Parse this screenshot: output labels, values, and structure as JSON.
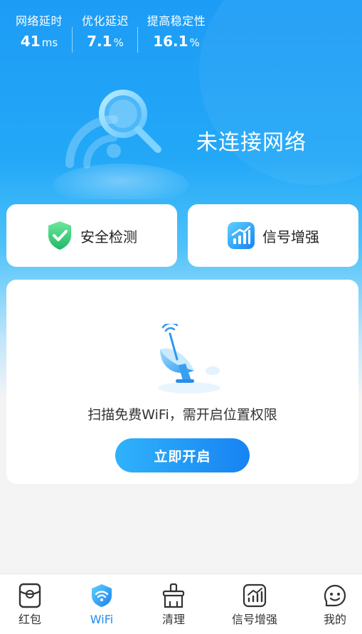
{
  "stats": [
    {
      "label": "网络延时",
      "value": "41",
      "unit": "ms"
    },
    {
      "label": "优化延迟",
      "value": "7.1",
      "unit": "%"
    },
    {
      "label": "提高稳定性",
      "value": "16.1",
      "unit": "%"
    }
  ],
  "hero": {
    "status": "未连接网络",
    "icon": "magnifier-radar-icon"
  },
  "actions": [
    {
      "label": "安全检测",
      "icon": "shield-check-icon"
    },
    {
      "label": "信号增强",
      "icon": "signal-chart-icon"
    }
  ],
  "scan": {
    "message": "扫描免费WiFi，需开启位置权限",
    "button": "立即开启",
    "icon": "satellite-dish-icon"
  },
  "tabs": [
    {
      "label": "红包",
      "icon": "red-packet-icon"
    },
    {
      "label": "WiFi",
      "icon": "wifi-icon"
    },
    {
      "label": "清理",
      "icon": "broom-icon"
    },
    {
      "label": "信号增强",
      "icon": "signal-chart-icon"
    },
    {
      "label": "我的",
      "icon": "profile-icon"
    }
  ],
  "colors": {
    "primary": "#1a8cf4",
    "hero_top": "#1d9cf6",
    "shield": "#3ccf7a"
  }
}
